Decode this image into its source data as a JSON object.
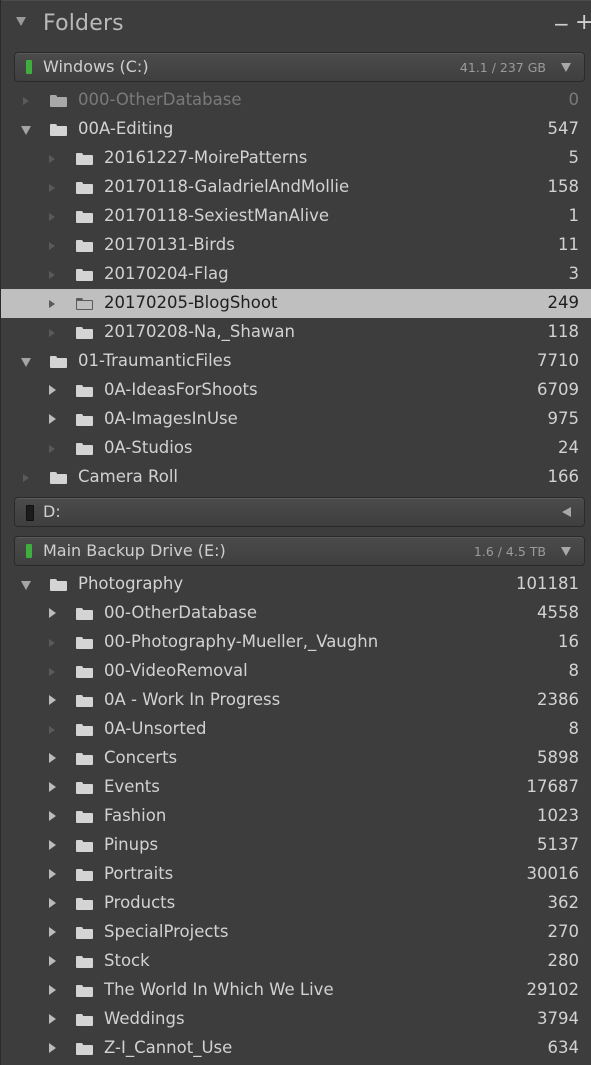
{
  "panel": {
    "title": "Folders",
    "minus_label": "−",
    "plus_label": "+"
  },
  "volumes": [
    {
      "name": "Windows (C:)",
      "size": "41.1 / 237 GB",
      "online": true,
      "expanded": true,
      "led_color": "#3fae3f"
    },
    {
      "name": "D:",
      "size": "",
      "online": false,
      "expanded": false,
      "led_color": "#1c1c1c"
    },
    {
      "name": "Main Backup Drive (E:)",
      "size": "1.6 / 4.5 TB",
      "online": true,
      "expanded": true,
      "led_color": "#3fae3f"
    }
  ],
  "folders_c": [
    {
      "name": "000-OtherDatabase",
      "count": "0",
      "level": 0,
      "toggle": "empty",
      "dim": true
    },
    {
      "name": "00A-Editing",
      "count": "547",
      "level": 0,
      "toggle": "open"
    },
    {
      "name": "20161227-MoirePatterns",
      "count": "5",
      "level": 1,
      "toggle": "empty"
    },
    {
      "name": "20170118-GaladrielAndMollie",
      "count": "158",
      "level": 1,
      "toggle": "empty"
    },
    {
      "name": "20170118-SexiestManAlive",
      "count": "1",
      "level": 1,
      "toggle": "empty"
    },
    {
      "name": "20170131-Birds",
      "count": "11",
      "level": 1,
      "toggle": "empty"
    },
    {
      "name": "20170204-Flag",
      "count": "3",
      "level": 1,
      "toggle": "empty"
    },
    {
      "name": "20170205-BlogShoot",
      "count": "249",
      "level": 1,
      "toggle": "empty",
      "selected": true
    },
    {
      "name": "20170208-Na,_Shawan",
      "count": "118",
      "level": 1,
      "toggle": "empty"
    },
    {
      "name": "01-TraumanticFiles",
      "count": "7710",
      "level": 0,
      "toggle": "open"
    },
    {
      "name": "0A-IdeasForShoots",
      "count": "6709",
      "level": 1,
      "toggle": "closed"
    },
    {
      "name": "0A-ImagesInUse",
      "count": "975",
      "level": 1,
      "toggle": "closed"
    },
    {
      "name": "0A-Studios",
      "count": "24",
      "level": 1,
      "toggle": "empty"
    },
    {
      "name": "Camera Roll",
      "count": "166",
      "level": 0,
      "toggle": "empty"
    }
  ],
  "folders_e": [
    {
      "name": "Photography",
      "count": "101181",
      "level": 0,
      "toggle": "open"
    },
    {
      "name": "00-OtherDatabase",
      "count": "4558",
      "level": 1,
      "toggle": "closed"
    },
    {
      "name": "00-Photography-Mueller,_Vaughn",
      "count": "16",
      "level": 1,
      "toggle": "empty"
    },
    {
      "name": "00-VideoRemoval",
      "count": "8",
      "level": 1,
      "toggle": "empty"
    },
    {
      "name": "0A - Work In Progress",
      "count": "2386",
      "level": 1,
      "toggle": "closed"
    },
    {
      "name": "0A-Unsorted",
      "count": "8",
      "level": 1,
      "toggle": "empty"
    },
    {
      "name": "Concerts",
      "count": "5898",
      "level": 1,
      "toggle": "closed"
    },
    {
      "name": "Events",
      "count": "17687",
      "level": 1,
      "toggle": "closed"
    },
    {
      "name": "Fashion",
      "count": "1023",
      "level": 1,
      "toggle": "closed"
    },
    {
      "name": "Pinups",
      "count": "5137",
      "level": 1,
      "toggle": "closed"
    },
    {
      "name": "Portraits",
      "count": "30016",
      "level": 1,
      "toggle": "closed"
    },
    {
      "name": "Products",
      "count": "362",
      "level": 1,
      "toggle": "closed"
    },
    {
      "name": "SpecialProjects",
      "count": "270",
      "level": 1,
      "toggle": "closed"
    },
    {
      "name": "Stock",
      "count": "280",
      "level": 1,
      "toggle": "closed"
    },
    {
      "name": "The World In Which We Live",
      "count": "29102",
      "level": 1,
      "toggle": "closed"
    },
    {
      "name": "Weddings",
      "count": "3794",
      "level": 1,
      "toggle": "closed"
    },
    {
      "name": "Z-I_Cannot_Use",
      "count": "634",
      "level": 1,
      "toggle": "closed"
    }
  ]
}
